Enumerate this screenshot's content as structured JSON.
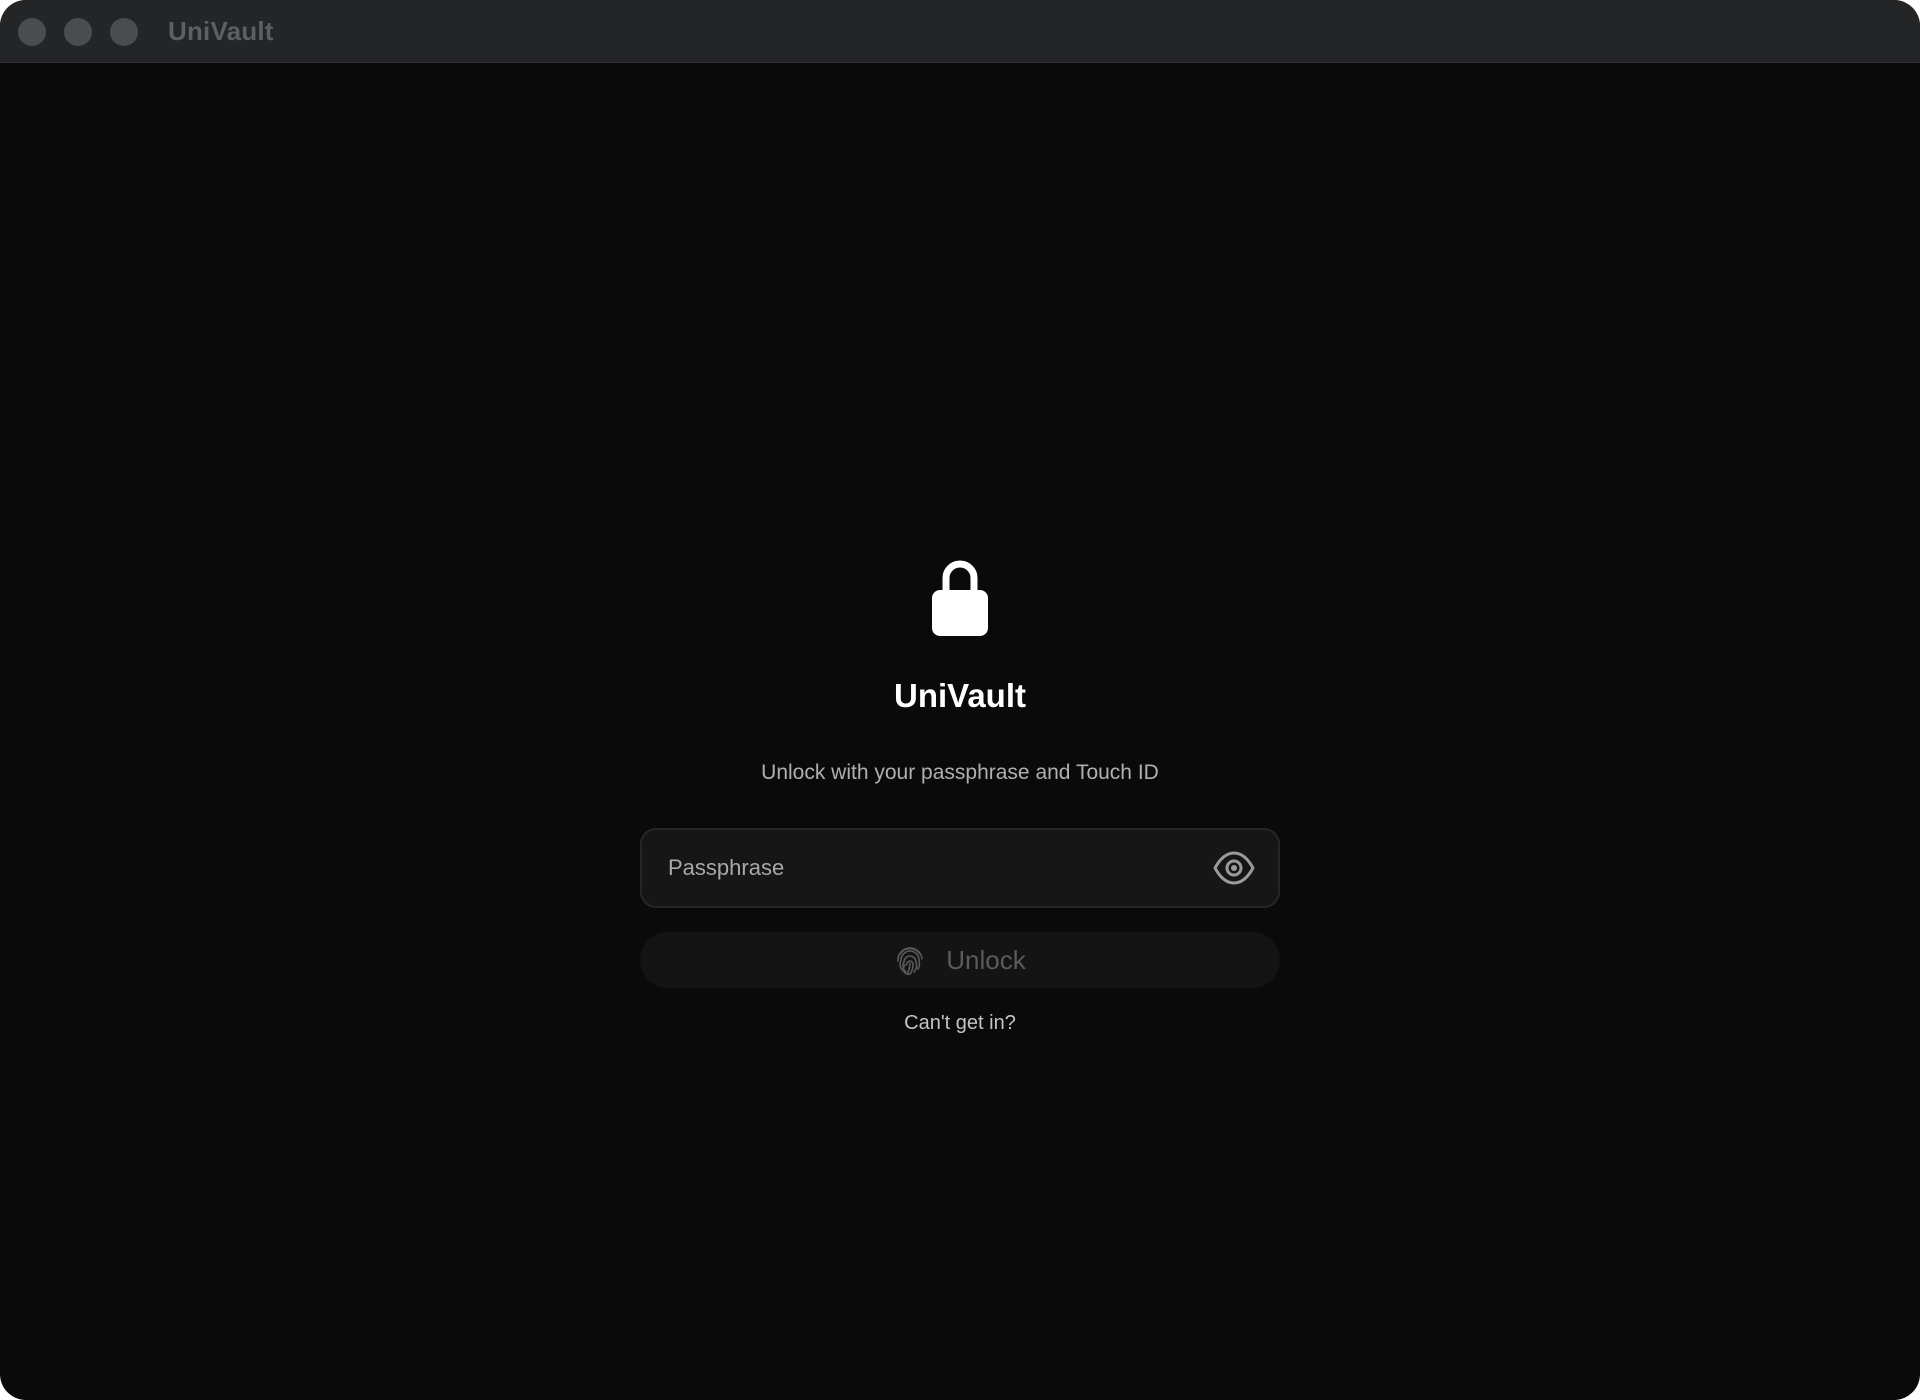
{
  "window": {
    "title": "UniVault"
  },
  "lock_screen": {
    "icon": "lock-icon",
    "app_name": "UniVault",
    "subtitle": "Unlock with your passphrase and Touch ID",
    "passphrase": {
      "value": "",
      "placeholder": "Passphrase",
      "toggle_icon": "eye-icon"
    },
    "unlock_button": {
      "label": "Unlock",
      "icon": "fingerprint-icon"
    },
    "help_link": "Can't get in?"
  },
  "colors": {
    "background": "#0a0a0a",
    "titlebar": "#232527",
    "field_background": "#161616",
    "button_background": "#141414",
    "text_primary": "#ffffff",
    "text_secondary": "#b0b0b0",
    "text_disabled": "#5a5a5a"
  }
}
